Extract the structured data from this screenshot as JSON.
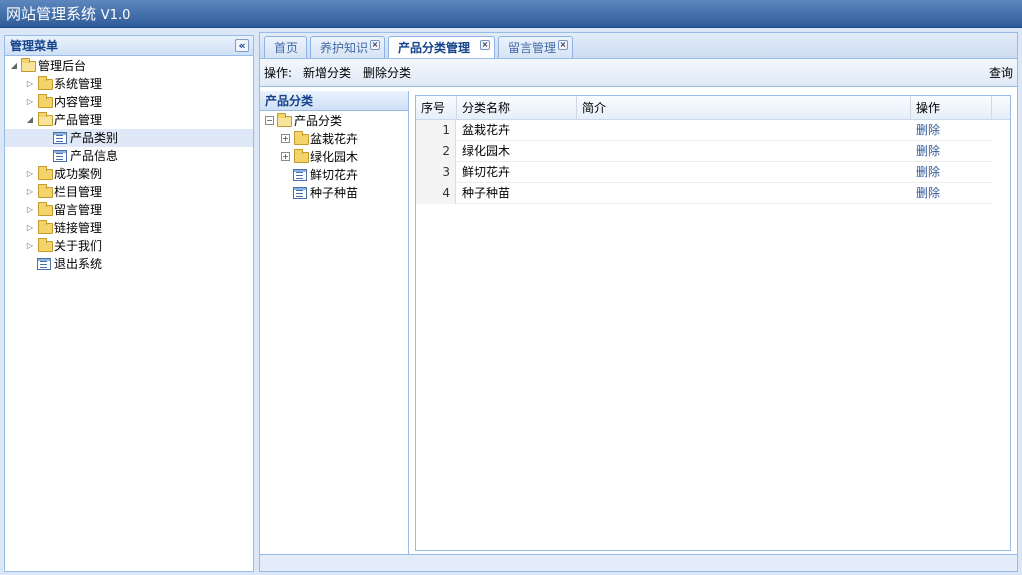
{
  "app": {
    "title": "网站管理系统",
    "version": "V1.0"
  },
  "sidebar": {
    "title": "管理菜单",
    "collapse_glyph": "«",
    "tree": [
      {
        "label": "管理后台"
      },
      {
        "label": "系统管理"
      },
      {
        "label": "内容管理"
      },
      {
        "label": "产品管理"
      },
      {
        "label": "产品类别"
      },
      {
        "label": "产品信息"
      },
      {
        "label": "成功案例"
      },
      {
        "label": "栏目管理"
      },
      {
        "label": "留言管理"
      },
      {
        "label": "链接管理"
      },
      {
        "label": "关于我们"
      },
      {
        "label": "退出系统"
      }
    ]
  },
  "tabs": [
    {
      "label": "首页"
    },
    {
      "label": "养护知识"
    },
    {
      "label": "产品分类管理"
    },
    {
      "label": "留言管理"
    }
  ],
  "toolbar": {
    "ops_label": "操作:",
    "add": "新增分类",
    "delete": "删除分类",
    "query": "查询"
  },
  "category_panel": {
    "title": "产品分类",
    "tree": [
      {
        "label": "产品分类"
      },
      {
        "label": "盆栽花卉"
      },
      {
        "label": "绿化园木"
      },
      {
        "label": "鲜切花卉"
      },
      {
        "label": "种子种苗"
      }
    ]
  },
  "grid": {
    "headers": [
      "序号",
      "分类名称",
      "简介",
      "操作"
    ],
    "rows": [
      {
        "idx": "1",
        "name": "盆栽花卉",
        "desc": "",
        "action": "删除"
      },
      {
        "idx": "2",
        "name": "绿化园木",
        "desc": "",
        "action": "删除"
      },
      {
        "idx": "3",
        "name": "鲜切花卉",
        "desc": "",
        "action": "删除"
      },
      {
        "idx": "4",
        "name": "种子种苗",
        "desc": "",
        "action": "删除"
      }
    ]
  },
  "colors": {
    "titlebar": "#3a6aa8",
    "panel_border": "#99bbe8",
    "header_text": "#15428b",
    "link": "#315996"
  }
}
